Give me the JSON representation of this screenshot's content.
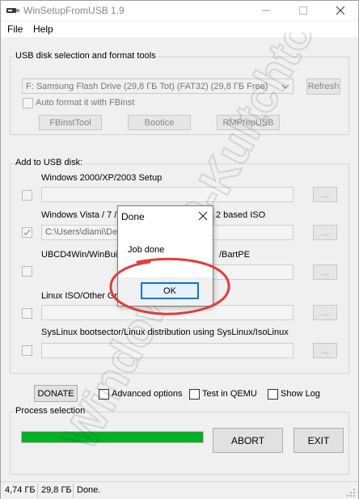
{
  "window": {
    "title": "WinSetupFromUSB 1.9"
  },
  "menu": {
    "items": [
      "File",
      "Help"
    ]
  },
  "usb_group": {
    "title": "USB disk selection and format tools",
    "disk_combo_value": "F: Samsung Flash Drive (29,8 ГБ Tot) (FAT32) (29,8 ГБ Free)",
    "refresh_label": "Refresh",
    "auto_format_label": "Auto format it with FBinst",
    "tools": [
      "FBinstTool",
      "Bootice",
      "RMPrepUSB"
    ]
  },
  "add_group": {
    "title": "Add to USB disk:",
    "sections": [
      {
        "label": "Windows 2000/XP/2003 Setup",
        "path": "",
        "checked": false
      },
      {
        "label": "Windows Vista / 7 /",
        "label_tail": "2 based ISO",
        "path": "C:\\Users\\diami\\Des",
        "checked": true
      },
      {
        "label": "UBCD4Win/WinBuild",
        "label_tail": "/BartPE",
        "path": "",
        "checked": false
      },
      {
        "label": "Linux ISO/Other Gr",
        "path": "",
        "checked": false
      },
      {
        "label": "SysLinux bootsector/Linux distribution using SysLinux/IsoLinux",
        "path": "",
        "checked": false
      }
    ],
    "browse_label": "..."
  },
  "options": {
    "donate_label": "DONATE",
    "advanced_label": "Advanced options",
    "qemu_label": "Test in QEMU",
    "log_label": "Show Log"
  },
  "process": {
    "title": "Process selection",
    "progress_fraction": 1.0,
    "progress_color": "#06b025",
    "abort_label": "ABORT",
    "exit_label": "EXIT"
  },
  "status": {
    "cells": [
      "4,74 ГБ",
      "29,8 ГБ",
      "Done."
    ]
  },
  "dialog": {
    "title": "Done",
    "message": "Job done",
    "ok_label": "OK"
  },
  "annotation_color": "#e23c3c",
  "watermark_text": "Windows-10-Kultchtonet"
}
